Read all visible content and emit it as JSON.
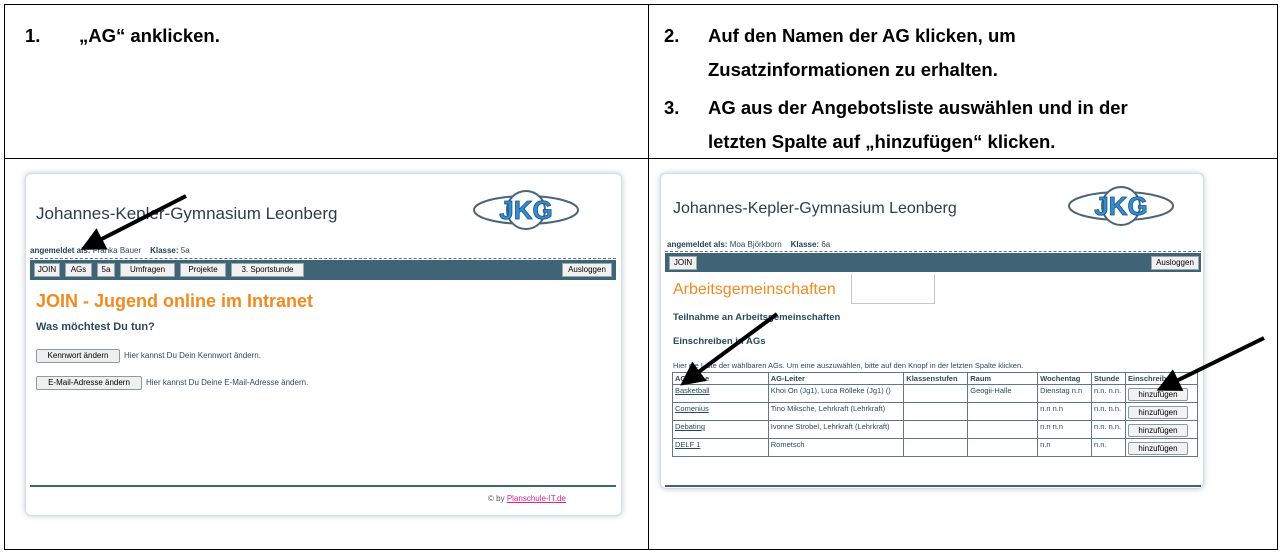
{
  "steps": {
    "s1": {
      "num": "1.",
      "text": "„AG“ anklicken."
    },
    "s2": {
      "num": "2.",
      "line1": "Auf den Namen der AG klicken, um",
      "line2": "Zusatzinformationen zu erhalten."
    },
    "s3": {
      "num": "3.",
      "line1": "AG aus der Angebotsliste auswählen und in der",
      "line2": "letzten Spalte auf „hinzufügen“ klicken."
    }
  },
  "left": {
    "site_title": "Johannes-Kepler-Gymnasium Leonberg",
    "logo_text": "JKG",
    "user_label": "angemeldet als:",
    "user_name": "Franka Bauer",
    "class_label": "Klasse:",
    "class_value": "5a",
    "nav": [
      "JOIN",
      "AGs",
      "5a",
      "Umfragen",
      "Projekte",
      "3. Sportstunde"
    ],
    "logout": "Ausloggen",
    "heading": "JOIN - Jugend online im Intranet",
    "question": "Was möchtest Du tun?",
    "btn_password": "Kennwort ändern",
    "desc_password": "Hier kannst Du Dein Kennwort ändern.",
    "btn_email": "E-Mail-Adresse ändern",
    "desc_email": "Hier kannst Du Deine E-Mail-Adresse ändern.",
    "footer_prefix": "© by",
    "footer_link": "Planschule-IT.de"
  },
  "right": {
    "site_title": "Johannes-Kepler-Gymnasium Leonberg",
    "logo_text": "JKG",
    "user_label": "angemeldet als:",
    "user_name": "Moa Björkborn",
    "class_label": "Klasse:",
    "class_value": "6a",
    "nav": [
      "JOIN"
    ],
    "logout": "Ausloggen",
    "heading": "Arbeitsgemeinschaften",
    "sub1": "Teilnahme an Arbeitsgemeinschaften",
    "sub2": "Einschreiben in AGs",
    "intro": "Hier die Liste der wählbaren AGs. Um eine auszuwählen, bitte auf den Knopf in der letzten Spalte klicken.",
    "headers": [
      "AG-Name",
      "AG-Leiter",
      "Klassenstufen",
      "Raum",
      "Wochentag",
      "Stunde",
      "Einschreiben"
    ],
    "rows": [
      {
        "name": "Basketball",
        "leader": "Khoi On (Jg1), Luca Rölleke (Jg1) ()",
        "levels": "",
        "room": "Geogii-Halle",
        "day": "Dienstag n.n",
        "hour": "n.n. n.n.",
        "action": "hinzufügen"
      },
      {
        "name": "Comenius",
        "leader": "Tino Miksche, Lehrkraft (Lehrkraft)",
        "levels": "",
        "room": "",
        "day": "n.n n.n",
        "hour": "n.n. n.n.",
        "action": "hinzufügen"
      },
      {
        "name": "Debating",
        "leader": "Ivonne Strobel, Lehrkraft (Lehrkraft)",
        "levels": "",
        "room": "",
        "day": "n.n n.n",
        "hour": "n.n. n.n.",
        "action": "hinzufügen"
      },
      {
        "name": "DELF 1",
        "leader": "Rometsch",
        "levels": "",
        "room": "",
        "day": "n.n",
        "hour": "n.n.",
        "action": "hinzufügen"
      }
    ]
  }
}
